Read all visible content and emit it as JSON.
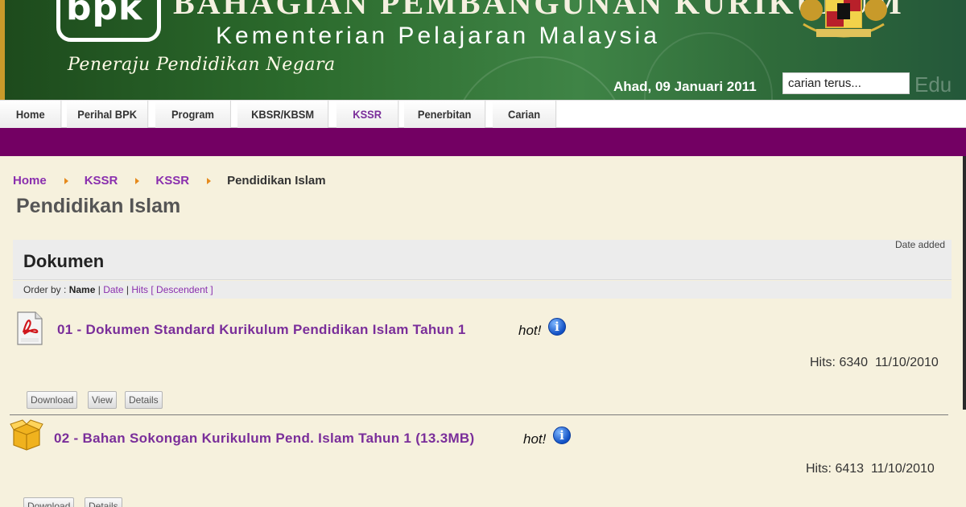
{
  "banner": {
    "logo_text": "bpk",
    "title": "BAHAGIAN PEMBANGUNAN KURIKULUM",
    "subtitle": "Kementerian Pelajaran Malaysia",
    "slogan": "Peneraju Pendidikan Negara",
    "date": "Ahad, 09 Januari 2011",
    "search_value": "carian terus...",
    "watermark": "Edu"
  },
  "nav": {
    "items": [
      {
        "label": "Home"
      },
      {
        "label": "Perihal BPK"
      },
      {
        "label": "Program"
      },
      {
        "label": "KBSR/KBSM"
      },
      {
        "label": "KSSR"
      },
      {
        "label": "Penerbitan"
      },
      {
        "label": "Carian"
      }
    ],
    "active": "KSSR",
    "colors": {
      "bar": "#730063",
      "active_text": "#7a2e9a"
    }
  },
  "breadcrumb": {
    "items": [
      "Home",
      "KSSR",
      "KSSR"
    ],
    "current": "Pendidikan Islam"
  },
  "page_title": "Pendidikan Islam",
  "documents": {
    "heading": "Dokumen",
    "date_added_label": "Date added",
    "order": {
      "prefix": "Order by :",
      "name": "Name",
      "sep": "|",
      "date": "Date",
      "hits": "Hits",
      "direction": "[ Descendent ]"
    },
    "items": [
      {
        "icon": "pdf-file-icon",
        "title": "01 - Dokumen Standard Kurikulum Pendidikan Islam Tahun 1",
        "hot": "hot!",
        "hits": "Hits: 6340",
        "date": "11/10/2010",
        "buttons": [
          "Download",
          "View",
          "Details"
        ]
      },
      {
        "icon": "package-box-icon",
        "title": "02 - Bahan Sokongan Kurikulum Pend. Islam Tahun 1 (13.3MB)",
        "hot": "hot!",
        "hits": "Hits: 6413",
        "date": "11/10/2010",
        "buttons": [
          "Download",
          "Details"
        ]
      }
    ]
  }
}
